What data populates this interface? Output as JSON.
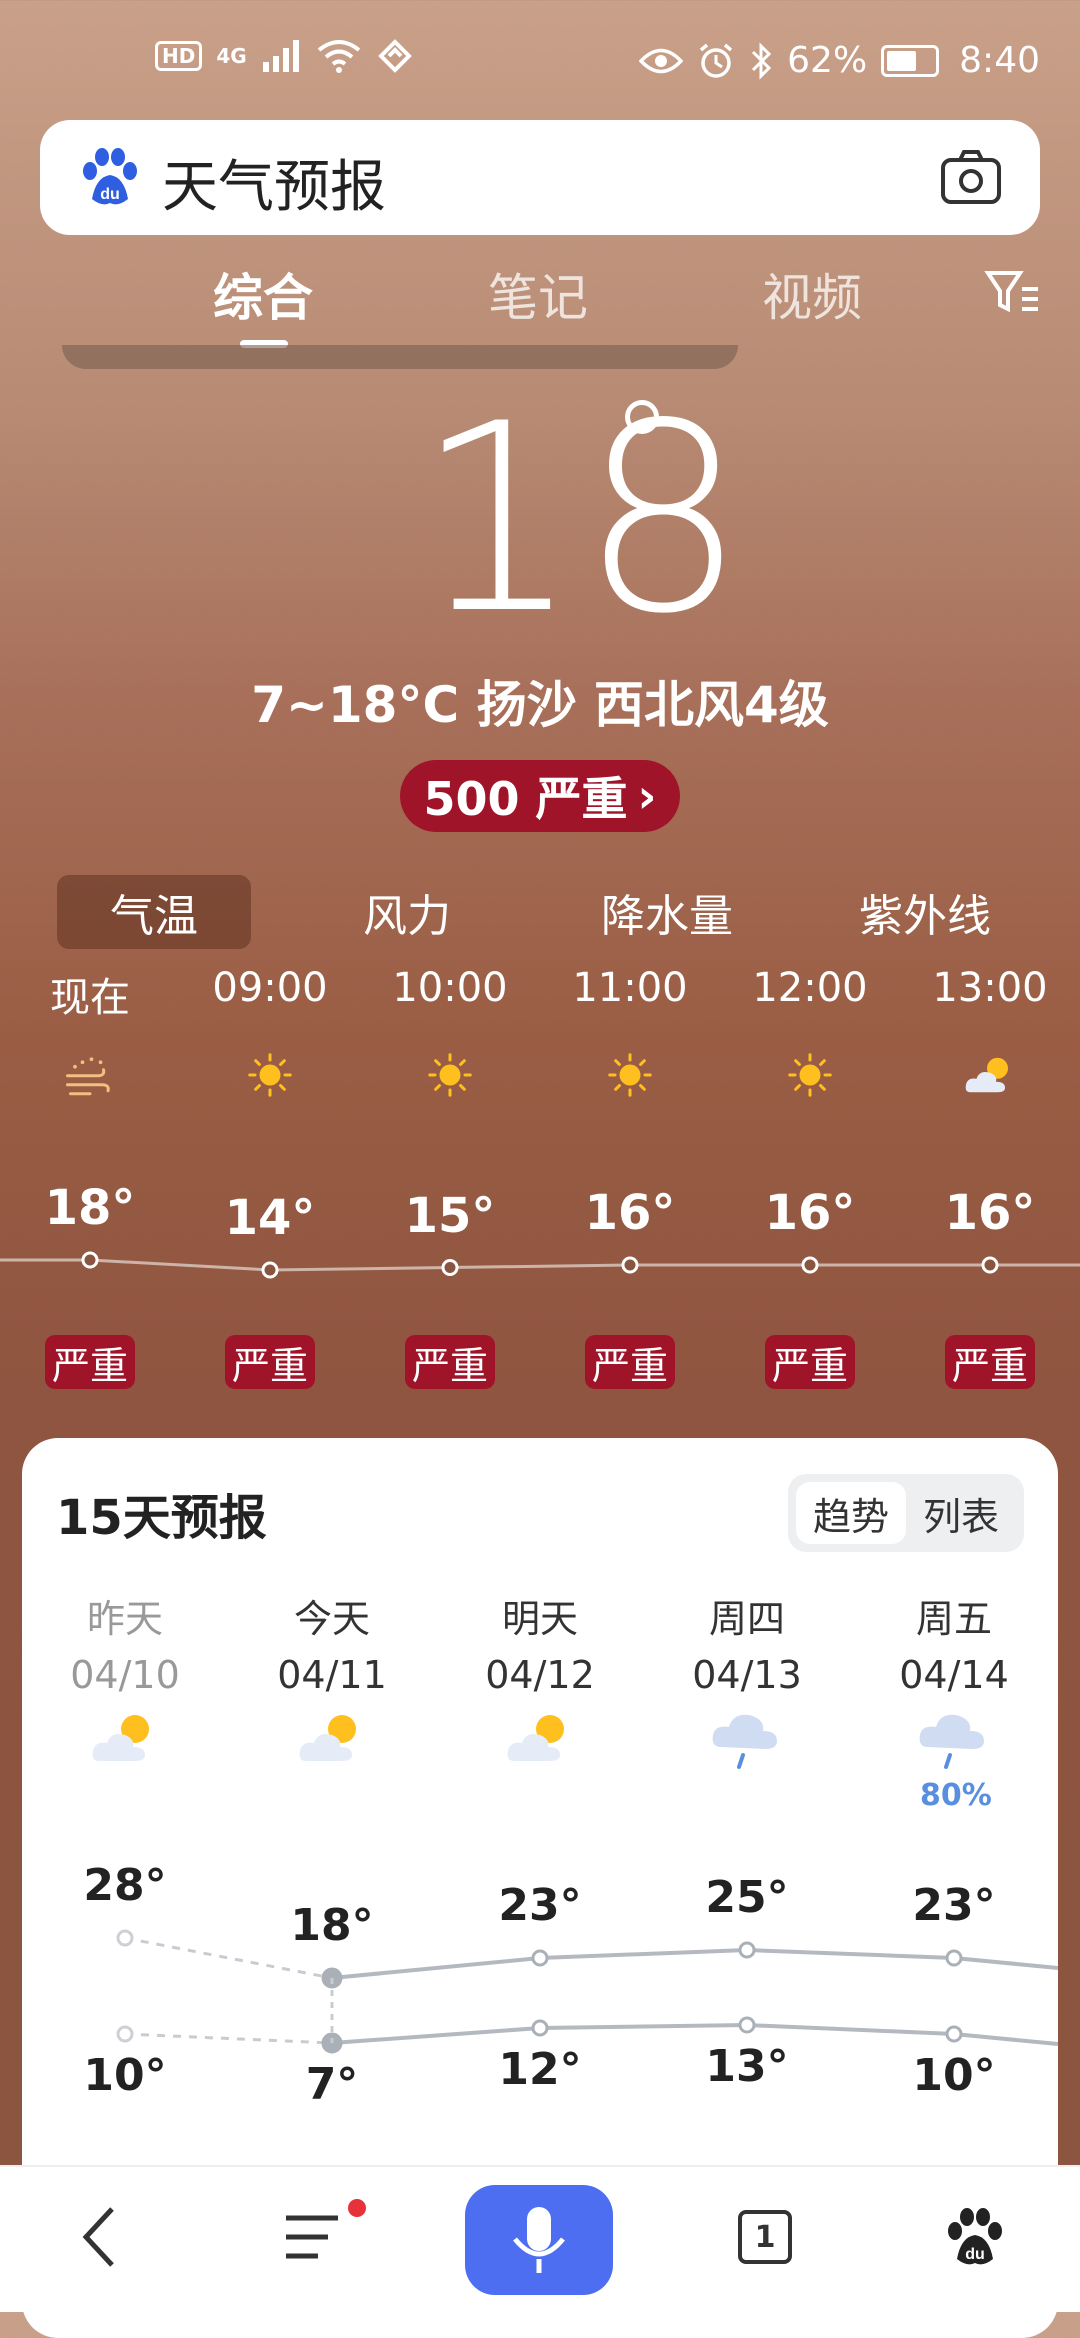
{
  "status_bar": {
    "hd": "HD",
    "network": "4G",
    "battery": "62%",
    "time": "8:40",
    "battery_level": 0.62
  },
  "search": {
    "query": "天气预报"
  },
  "tabs": [
    {
      "label": "综合"
    },
    {
      "label": "笔记"
    },
    {
      "label": "视频"
    }
  ],
  "current": {
    "temp": "18",
    "summary": "7~18°C 扬沙 西北风4级",
    "aqi": "500 严重"
  },
  "metric_tabs": [
    {
      "label": "气温"
    },
    {
      "label": "风力"
    },
    {
      "label": "降水量"
    },
    {
      "label": "紫外线"
    }
  ],
  "hourly": [
    {
      "time": "现在",
      "temp": "18°",
      "quality": "严重",
      "icon": "sand-dust-icon",
      "value": 18
    },
    {
      "time": "09:00",
      "temp": "14°",
      "quality": "严重",
      "icon": "sun-icon",
      "value": 14
    },
    {
      "time": "10:00",
      "temp": "15°",
      "quality": "严重",
      "icon": "sun-icon",
      "value": 15
    },
    {
      "time": "11:00",
      "temp": "16°",
      "quality": "严重",
      "icon": "sun-icon",
      "value": 16
    },
    {
      "time": "12:00",
      "temp": "16°",
      "quality": "严重",
      "icon": "sun-icon",
      "value": 16
    },
    {
      "time": "13:00",
      "temp": "16°",
      "quality": "严重",
      "icon": "partly-cloudy-icon",
      "value": 16
    }
  ],
  "forecast": {
    "title": "15天预报",
    "toggle": [
      "趋势",
      "列表"
    ],
    "days": [
      {
        "name": "昨天",
        "date": "04/10",
        "high": "28°",
        "low": "10°",
        "icon": "partly-cloudy-icon",
        "precip": ""
      },
      {
        "name": "今天",
        "date": "04/11",
        "high": "18°",
        "low": "7°",
        "icon": "partly-cloudy-icon",
        "precip": ""
      },
      {
        "name": "明天",
        "date": "04/12",
        "high": "23°",
        "low": "12°",
        "icon": "partly-cloudy-icon",
        "precip": ""
      },
      {
        "name": "周四",
        "date": "04/13",
        "high": "25°",
        "low": "13°",
        "icon": "rain-cloud-icon",
        "precip": ""
      },
      {
        "name": "周五",
        "date": "04/14",
        "high": "23°",
        "low": "10°",
        "icon": "rain-cloud-icon",
        "precip": "80%"
      }
    ]
  },
  "nav": {
    "tab_count": "1"
  },
  "colors": {
    "aqi_red": "#a0142a",
    "accent_blue": "#4e6ef2",
    "badge_dot": "#e8323a"
  }
}
